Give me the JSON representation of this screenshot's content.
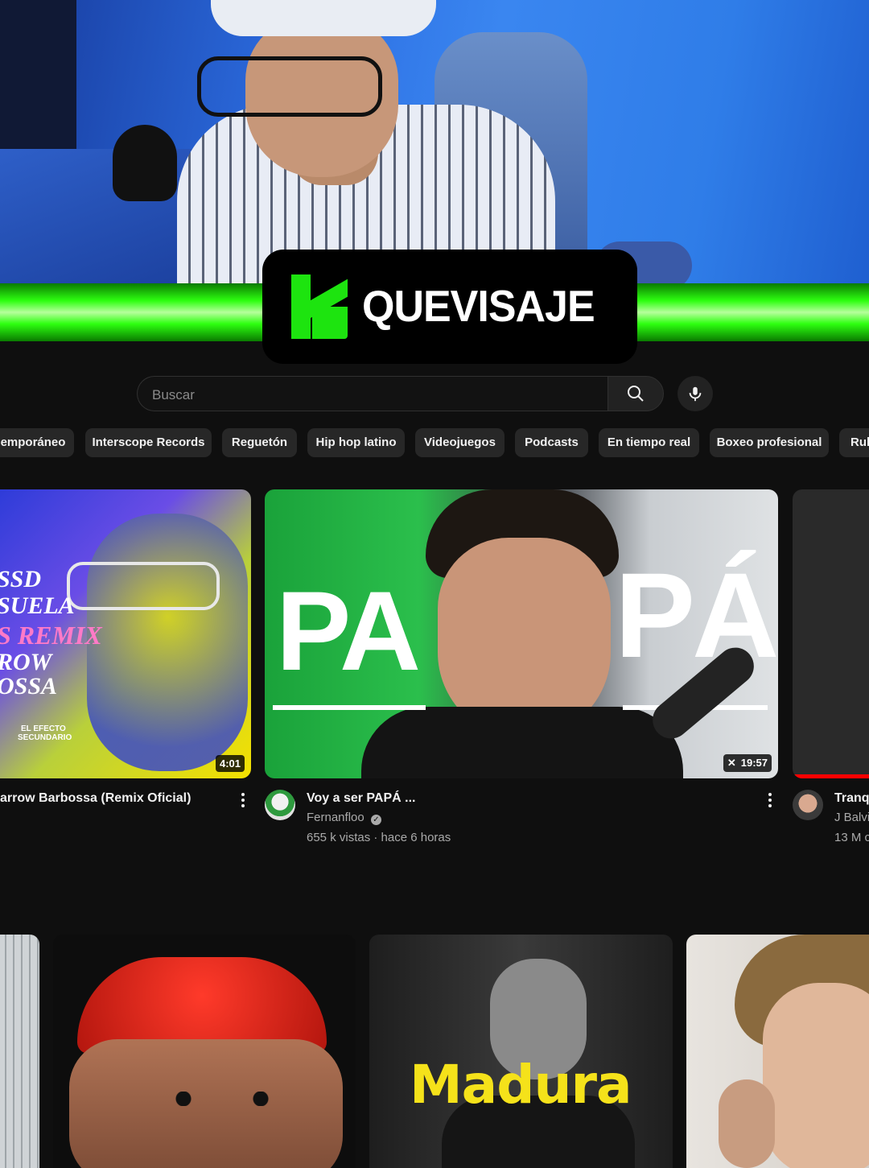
{
  "overlay": {
    "brand_name": "QUEVISAJE",
    "brand_color": "#1de40f"
  },
  "search": {
    "placeholder": "Buscar"
  },
  "chips": [
    "emporáneo",
    "Interscope Records",
    "Reguetón",
    "Hip hop latino",
    "Videojuegos",
    "Podcasts",
    "En tiempo real",
    "Boxeo profesional",
    "Rul"
  ],
  "videos": [
    {
      "thumb_text": [
        "SSD",
        "SUELA",
        "S REMIX",
        "ROW",
        "OSSA"
      ],
      "thumb_badge": [
        "EL EFECTO",
        "SECUNDARIO"
      ],
      "duration": "4:01",
      "title": "arrow Barbossa (Remix Oficial)"
    },
    {
      "thumb_text": [
        "PA",
        "PÁ"
      ],
      "duration": "19:57",
      "title": "Voy a ser PAPÁ ...",
      "channel": "Fernanfloo",
      "meta": "655 k vistas · hace 6 horas"
    },
    {
      "title": "Tranq",
      "channel": "J Balvi",
      "meta": "13 M c"
    }
  ],
  "row2": {
    "madura_text": "Madura"
  }
}
